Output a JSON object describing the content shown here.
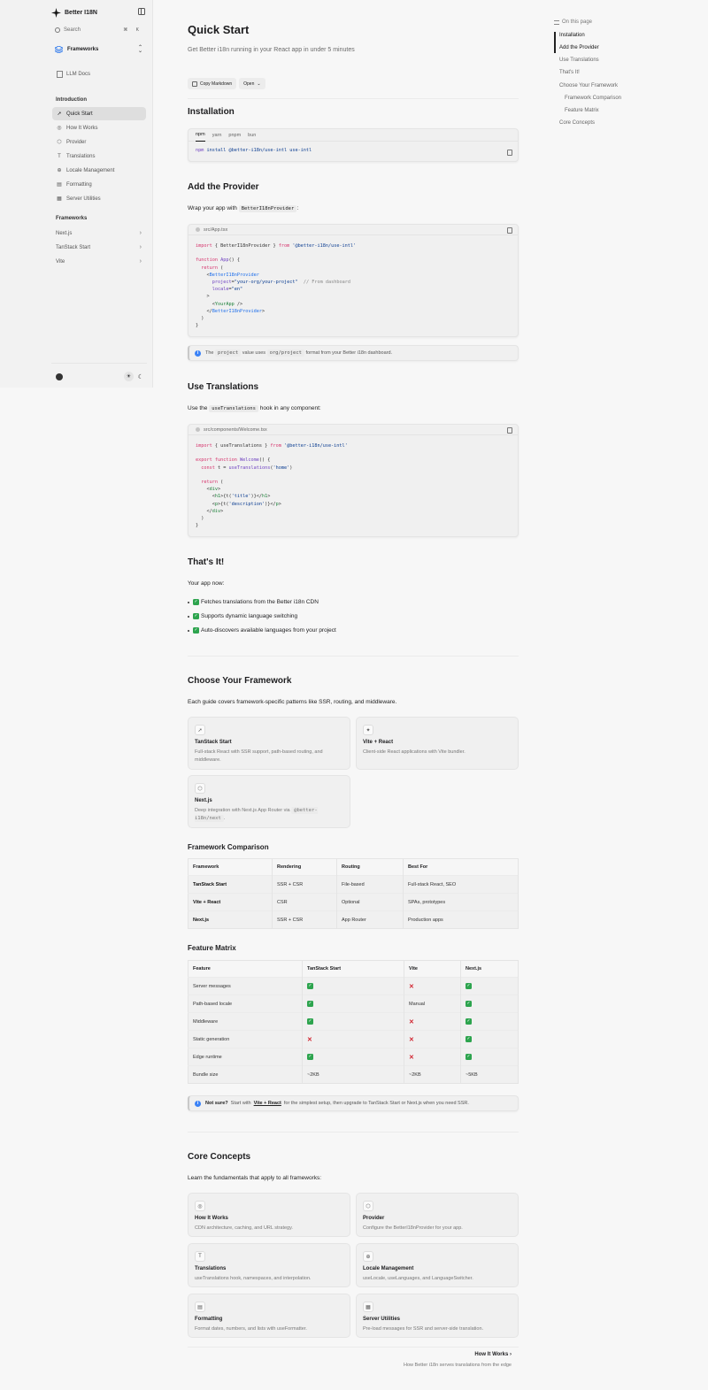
{
  "sidebar": {
    "brand": "Better I18N",
    "search_placeholder": "Search",
    "search_shortcut": "⌘ K",
    "framework_select": "Frameworks",
    "llm_docs": "LLM Docs",
    "intro_heading": "Introduction",
    "intro_items": [
      "Quick Start",
      "How It Works",
      "Provider",
      "Translations",
      "Locale Management",
      "Formatting",
      "Server Utilities"
    ],
    "frameworks_heading": "Frameworks",
    "framework_items": [
      "Next.js",
      "TanStack Start",
      "Vite"
    ]
  },
  "page": {
    "title": "Quick Start",
    "lead": "Get Better i18n running in your React app in under 5 minutes",
    "copy_markdown": "Copy Markdown",
    "open": "Open",
    "installation": {
      "heading": "Installation",
      "tabs": [
        "npm",
        "yarn",
        "pnpm",
        "bun"
      ]
    },
    "add_provider": {
      "heading": "Add the Provider",
      "text_before": "Wrap your app with",
      "code_inline": "BetterI18nProvider",
      "text_after": ":",
      "filename": "src/App.tsx",
      "callout_a": "The",
      "callout_code1": "project",
      "callout_b": "value uses",
      "callout_code2": "org/project",
      "callout_c": "format from your Better i18n dashboard."
    },
    "use_translations": {
      "heading": "Use Translations",
      "text_before": "Use the",
      "code_inline": "useTranslations",
      "text_after": "hook in any component:",
      "filename": "src/components/Welcome.tsx"
    },
    "thats_it": {
      "heading": "That's It!",
      "text": "Your app now:",
      "bullets": [
        "Fetches translations from the Better i18n CDN",
        "Supports dynamic language switching",
        "Auto-discovers available languages from your project"
      ]
    },
    "choose_framework": {
      "heading": "Choose Your Framework",
      "text": "Each guide covers framework-specific patterns like SSR, routing, and middleware.",
      "cards": [
        {
          "title": "TanStack Start",
          "desc": "Full-stack React with SSR support, path-based routing, and middleware."
        },
        {
          "title": "Vite + React",
          "desc": "Client-side React applications with Vite bundler."
        },
        {
          "title": "Next.js",
          "desc_a": "Deep integration with Next.js App Router via",
          "desc_code": "@better-i18n/next",
          "desc_b": "."
        }
      ]
    },
    "comparison": {
      "heading": "Framework Comparison",
      "columns": [
        "Framework",
        "Rendering",
        "Routing",
        "Best For"
      ],
      "rows": [
        [
          "TanStack Start",
          "SSR + CSR",
          "File-based",
          "Full-stack React, SEO"
        ],
        [
          "Vite + React",
          "CSR",
          "Optional",
          "SPAs, prototypes"
        ],
        [
          "Next.js",
          "SSR + CSR",
          "App Router",
          "Production apps"
        ]
      ]
    },
    "matrix": {
      "heading": "Feature Matrix",
      "columns": [
        "Feature",
        "TanStack Start",
        "Vite",
        "Next.js"
      ],
      "rows": [
        [
          "Server messages",
          "✅",
          "❌",
          "✅"
        ],
        [
          "Path-based locale",
          "✅",
          "Manual",
          "✅"
        ],
        [
          "Middleware",
          "✅",
          "❌",
          "✅"
        ],
        [
          "Static generation",
          "❌",
          "❌",
          "✅"
        ],
        [
          "Edge runtime",
          "✅",
          "❌",
          "✅"
        ],
        [
          "Bundle size",
          "~2KB",
          "~2KB",
          "~5KB"
        ]
      ],
      "callout_bold": "Not sure?",
      "callout_a": "Start with",
      "callout_link": "Vite + React",
      "callout_b": "for the simplest setup, then upgrade to TanStack Start or Next.js when you need SSR."
    },
    "core": {
      "heading": "Core Concepts",
      "text": "Learn the fundamentals that apply to all frameworks:",
      "cards": [
        {
          "title": "How It Works",
          "desc": "CDN architecture, caching, and URL strategy."
        },
        {
          "title": "Provider",
          "desc": "Configure the BetterI18nProvider for your app."
        },
        {
          "title": "Translations",
          "desc": "useTranslations hook, namespaces, and interpolation."
        },
        {
          "title": "Locale Management",
          "desc": "useLocale, useLanguages, and LanguageSwitcher."
        },
        {
          "title": "Formatting",
          "desc": "Format dates, numbers, and lists with useFormatter."
        },
        {
          "title": "Server Utilities",
          "desc": "Pre-load messages for SSR and server-side translation."
        }
      ]
    },
    "next": {
      "title": "How It Works",
      "desc": "How Better i18n serves translations from the edge"
    }
  },
  "toc": {
    "title": "On this page",
    "items": [
      "Installation",
      "Add the Provider",
      "Use Translations",
      "That's It!",
      "Choose Your Framework",
      "Framework Comparison",
      "Feature Matrix",
      "Core Concepts"
    ]
  }
}
